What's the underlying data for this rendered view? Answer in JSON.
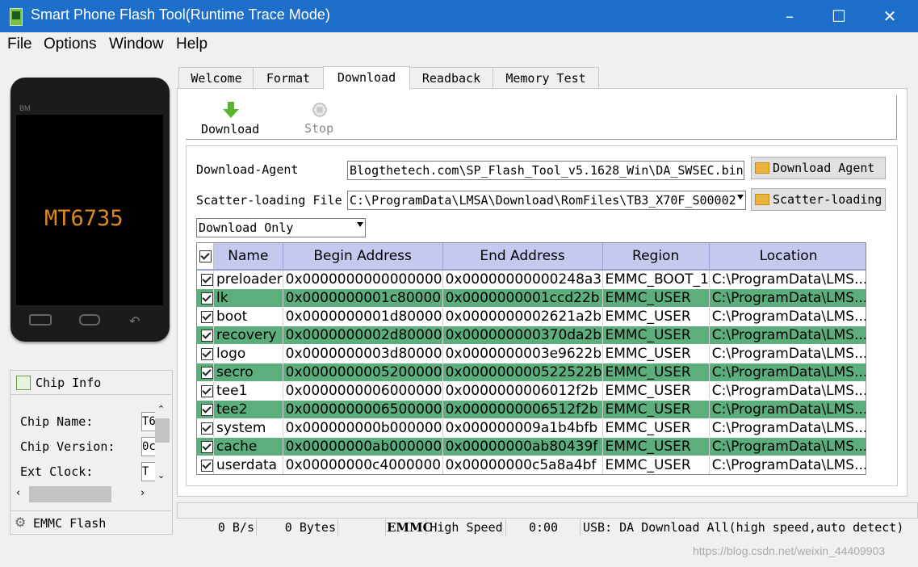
{
  "window": {
    "title": "Smart Phone Flash Tool(Runtime Trace Mode)",
    "minimize_icon": "minimize-icon",
    "maximize_icon": "maximize-icon",
    "close_icon": "close-icon"
  },
  "menu": {
    "file": "File",
    "options": "Options",
    "window": "Window",
    "help": "Help"
  },
  "phone": {
    "label": "MT6735",
    "brand": "BM"
  },
  "chip_info": {
    "header": "Chip Info",
    "fields": [
      {
        "label": "Chip Name:",
        "value": "T6"
      },
      {
        "label": "Chip Version:",
        "value": "0c"
      },
      {
        "label": "Ext Clock:",
        "value": "T"
      }
    ],
    "emmc_flash": "EMMC Flash"
  },
  "tabs": [
    "Welcome",
    "Format",
    "Download",
    "Readback",
    "Memory Test"
  ],
  "active_tab": "Download",
  "toolbar": {
    "download": "Download",
    "stop": "Stop"
  },
  "download_agent": {
    "label": "Download-Agent",
    "value": "Blogthetech.com\\SP_Flash_Tool_v5.1628_Win\\DA_SWSEC.bin",
    "button": "Download Agent"
  },
  "scatter": {
    "label": "Scatter-loading File",
    "value": "C:\\ProgramData\\LMSA\\Download\\RomFiles\\TB3_X70F_S00002",
    "button": "Scatter-loading"
  },
  "mode_select": {
    "selected": "Download Only"
  },
  "table": {
    "headers": [
      "Name",
      "Begin Address",
      "End Address",
      "Region",
      "Location"
    ],
    "rows": [
      {
        "name": "preloader",
        "begin": "0x0000000000000000",
        "end": "0x00000000000248a3",
        "region": "EMMC_BOOT_1",
        "location": "C:\\ProgramData\\LMS..."
      },
      {
        "name": "lk",
        "begin": "0x0000000001c80000",
        "end": "0x0000000001ccd22b",
        "region": "EMMC_USER",
        "location": "C:\\ProgramData\\LMS..."
      },
      {
        "name": "boot",
        "begin": "0x0000000001d80000",
        "end": "0x0000000002621a2b",
        "region": "EMMC_USER",
        "location": "C:\\ProgramData\\LMS..."
      },
      {
        "name": "recovery",
        "begin": "0x0000000002d80000",
        "end": "0x000000000370da2b",
        "region": "EMMC_USER",
        "location": "C:\\ProgramData\\LMS..."
      },
      {
        "name": "logo",
        "begin": "0x0000000003d80000",
        "end": "0x0000000003e9622b",
        "region": "EMMC_USER",
        "location": "C:\\ProgramData\\LMS..."
      },
      {
        "name": "secro",
        "begin": "0x0000000005200000",
        "end": "0x000000000522522b",
        "region": "EMMC_USER",
        "location": "C:\\ProgramData\\LMS..."
      },
      {
        "name": "tee1",
        "begin": "0x0000000006000000",
        "end": "0x0000000006012f2b",
        "region": "EMMC_USER",
        "location": "C:\\ProgramData\\LMS..."
      },
      {
        "name": "tee2",
        "begin": "0x0000000006500000",
        "end": "0x0000000006512f2b",
        "region": "EMMC_USER",
        "location": "C:\\ProgramData\\LMS..."
      },
      {
        "name": "system",
        "begin": "0x000000000b000000",
        "end": "0x000000009a1b4bfb",
        "region": "EMMC_USER",
        "location": "C:\\ProgramData\\LMS..."
      },
      {
        "name": "cache",
        "begin": "0x00000000ab000000",
        "end": "0x00000000ab80439f",
        "region": "EMMC_USER",
        "location": "C:\\ProgramData\\LMS..."
      },
      {
        "name": "userdata",
        "begin": "0x00000000c4000000",
        "end": "0x00000000c5a8a4bf",
        "region": "EMMC_USER",
        "location": "C:\\ProgramData\\LMS..."
      }
    ]
  },
  "status": {
    "speed": "0 B/s",
    "bytes": "0 Bytes",
    "storage": "EMMC",
    "mode": "High Speed",
    "time": "0:00",
    "usb": "USB: DA Download All(high speed,auto detect)"
  },
  "watermark": "https://blog.csdn.net/weixin_44409903",
  "colors": {
    "titlebar": "#1e6fc9",
    "row_highlight": "#5cae7d",
    "header_bg": "#c5c9f0",
    "phone_label": "#e08a1e"
  }
}
